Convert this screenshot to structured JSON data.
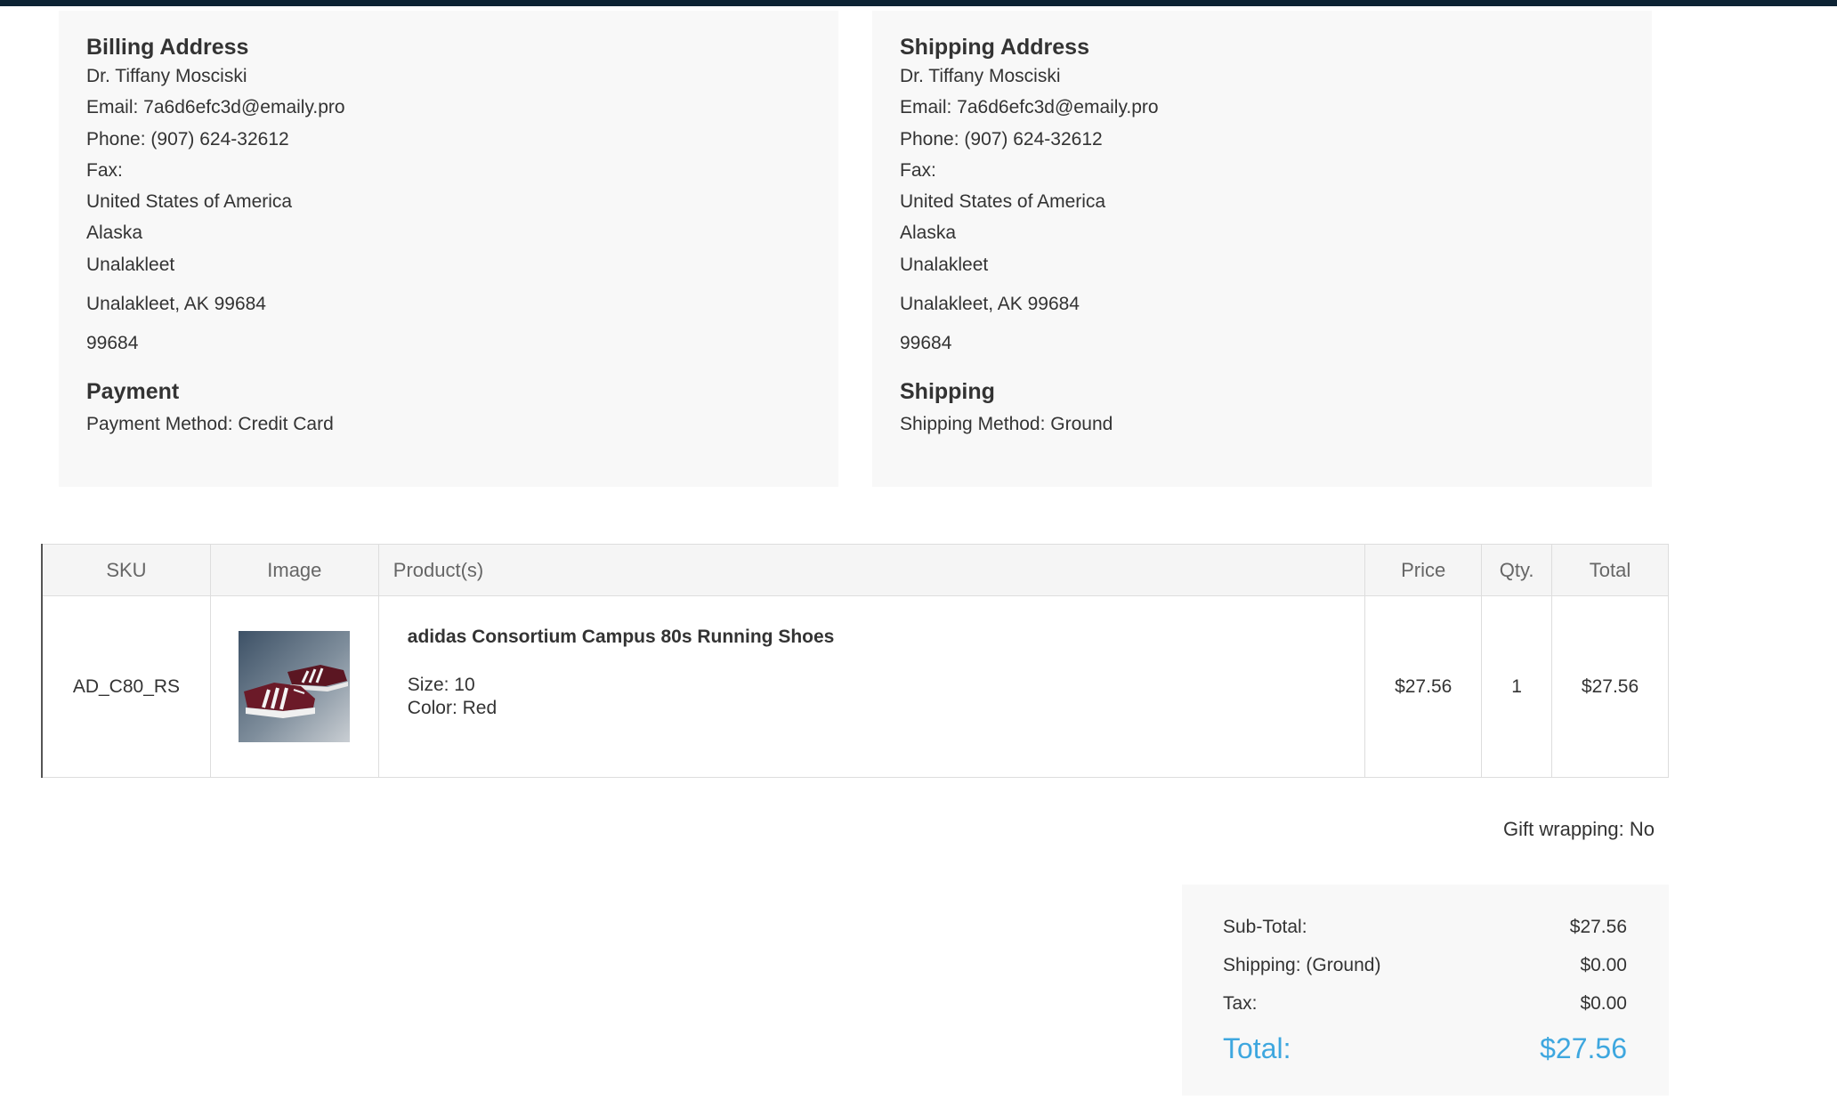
{
  "billing": {
    "title": "Billing Address",
    "name": "Dr. Tiffany Mosciski",
    "email": "Email: 7a6d6efc3d@emaily.pro",
    "phone": "Phone: (907) 624-32612",
    "fax": "Fax:",
    "country": "United States of America",
    "state": "Alaska",
    "city": "Unalakleet",
    "city_line": "Unalakleet, AK 99684",
    "zip": "99684"
  },
  "shipping_address": {
    "title": "Shipping Address",
    "name": "Dr. Tiffany Mosciski",
    "email": "Email: 7a6d6efc3d@emaily.pro",
    "phone": "Phone: (907) 624-32612",
    "fax": "Fax:",
    "country": "United States of America",
    "state": "Alaska",
    "city": "Unalakleet",
    "city_line": "Unalakleet, AK 99684",
    "zip": "99684"
  },
  "payment": {
    "title": "Payment",
    "method": "Payment Method: Credit Card"
  },
  "shipping": {
    "title": "Shipping",
    "method": "Shipping Method: Ground"
  },
  "table": {
    "headers": {
      "sku": "SKU",
      "image": "Image",
      "product": "Product(s)",
      "price": "Price",
      "qty": "Qty.",
      "total": "Total"
    },
    "rows": [
      {
        "sku": "AD_C80_RS",
        "image_icon": "sneaker-image",
        "product_name": "adidas Consortium Campus 80s Running Shoes",
        "size": "Size: 10",
        "color": "Color: Red",
        "price": "$27.56",
        "qty": "1",
        "total": "$27.56"
      }
    ]
  },
  "gift_wrapping": "Gift wrapping: No",
  "totals": {
    "subtotal_label": "Sub-Total:",
    "subtotal": "$27.56",
    "shipping_label": "Shipping: (Ground)",
    "shipping": "$0.00",
    "tax_label": "Tax:",
    "tax": "$0.00",
    "total_label": "Total:",
    "total": "$27.56"
  },
  "colors": {
    "topbar": "#0d2334",
    "panel": "#f8f8f8",
    "accent": "#3ea7df"
  }
}
